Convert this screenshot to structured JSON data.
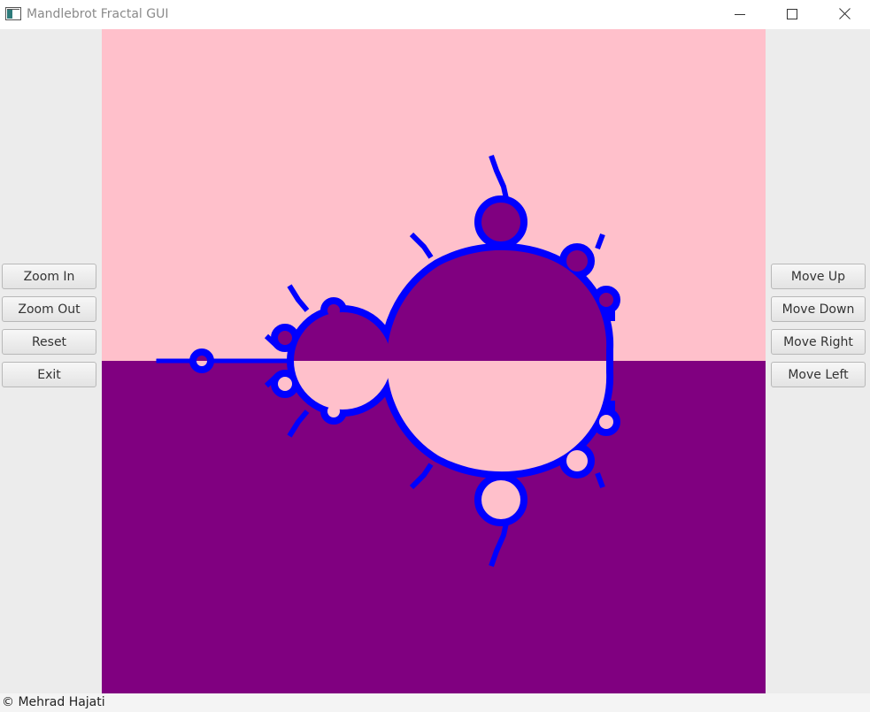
{
  "window": {
    "title": "Mandlebrot Fractal GUI",
    "icon": "app-window-icon",
    "controls": [
      "minimize-icon",
      "maximize-icon",
      "close-icon"
    ]
  },
  "left_controls": {
    "zoom_in": "Zoom In",
    "zoom_out": "Zoom Out",
    "reset": "Reset",
    "exit": "Exit"
  },
  "right_controls": {
    "move_up": "Move Up",
    "move_down": "Move Down",
    "move_right": "Move Right",
    "move_left": "Move Left"
  },
  "fractal": {
    "colors": {
      "background_top": "#ffc0cb",
      "background_bottom": "#800080",
      "boundary": "#0000ff",
      "set_top": "#800080",
      "set_bottom": "#ffc0cb"
    }
  },
  "footer": {
    "credit": "© Mehrad Hajati"
  }
}
